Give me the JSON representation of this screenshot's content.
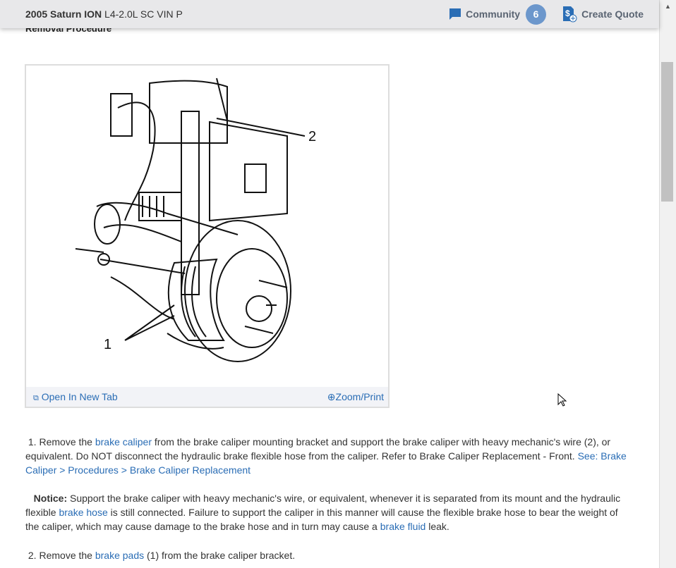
{
  "header": {
    "vehicle": "2005 Saturn ION",
    "engine": "L4-2.0L SC VIN P",
    "community_label": "Community",
    "community_count": "6",
    "quote_label": "Create Quote"
  },
  "section_title": "Removal Procedure",
  "figure": {
    "callout_1": "1",
    "callout_2": "2",
    "open_tab_label": "Open In New Tab",
    "zoom_label": "Zoom/Print"
  },
  "steps": [
    {
      "num": "1.",
      "t1": "Remove the ",
      "l1": "brake caliper",
      "t2": " from the brake caliper mounting bracket and support the brake caliper with heavy mechanic's wire (2), or equivalent. Do NOT disconnect the hydraulic brake flexible hose from the caliper. Refer to Brake Caliper Replacement - Front. ",
      "l2": "See: Brake Caliper > Procedures > Brake Caliper Replacement"
    },
    {
      "num": "2.",
      "t1": "Remove the ",
      "l1": "brake pads",
      "t2": " (1) from the brake caliper bracket."
    }
  ],
  "notice": {
    "label": "Notice:",
    "t1": " Support the brake caliper with heavy mechanic's wire, or equivalent, whenever it is separated from its mount and the hydraulic flexible ",
    "l1": "brake hose",
    "t2": " is still connected. Failure to support the caliper in this manner will cause the flexible brake hose to bear the weight of the caliper, which may cause damage to the brake hose and in turn may cause a ",
    "l2": "brake fluid",
    "t3": " leak."
  }
}
